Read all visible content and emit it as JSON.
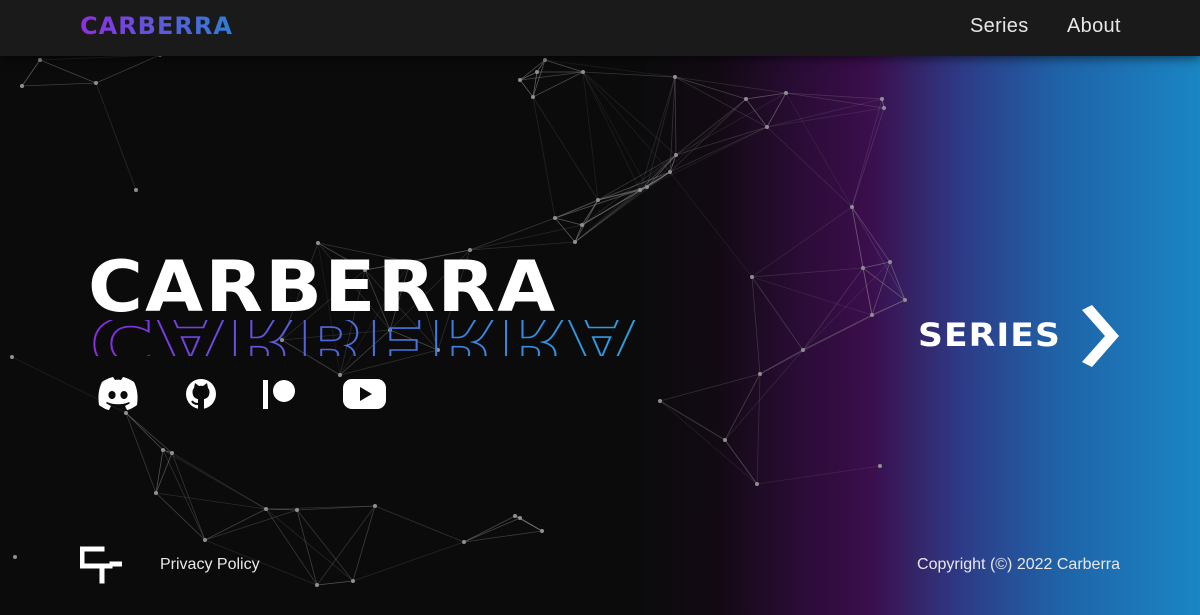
{
  "nav": {
    "logo": "CARBERRA",
    "links": [
      {
        "label": "Series"
      },
      {
        "label": "About"
      }
    ]
  },
  "hero": {
    "title": "CARBERRA",
    "echo_colors": [
      "#8a2be2",
      "#4a6fe0",
      "#2aa0e0"
    ]
  },
  "social": [
    {
      "name": "discord-icon"
    },
    {
      "name": "github-icon"
    },
    {
      "name": "patreon-icon"
    },
    {
      "name": "youtube-icon"
    }
  ],
  "cta": {
    "label": "SERIES",
    "icon": "chevron-right-icon"
  },
  "footer": {
    "logo_icon": "carberra-mark-icon",
    "privacy": "Privacy Policy",
    "copyright": "Copyright (©) 2022 Carberra"
  },
  "colors": {
    "brand_purple": "#8f2fe0",
    "brand_blue": "#2f7fd6",
    "navbar_bg": "#1a1a1b",
    "page_bg": "#0b0b0c"
  }
}
